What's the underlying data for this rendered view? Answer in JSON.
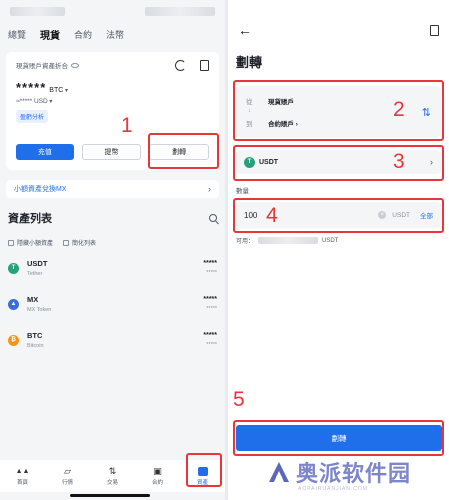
{
  "left": {
    "tabs": [
      "總覽",
      "現貨",
      "合約",
      "法幣"
    ],
    "card": {
      "title": "現貨賬戶資產折合",
      "balance_stars": "*****",
      "balance_unit": "BTC",
      "sub_balance": "≈***** USD",
      "pnl_label": "盈虧分析",
      "buttons": {
        "deposit": "充值",
        "withdraw": "提幣",
        "transfer": "劃轉"
      }
    },
    "promo": {
      "text": "小額資產兌換MX",
      "chevron": "›"
    },
    "list": {
      "title": "資產列表",
      "filter_hide_small": "隱藏小額資產",
      "filter_simple": "簡化列表",
      "coins": [
        {
          "symbol": "USDT",
          "name": "Tether",
          "value": "*****",
          "sub": "*****",
          "icon_letter": "T",
          "color": "#26a17b"
        },
        {
          "symbol": "MX",
          "name": "MX Token",
          "value": "*****",
          "sub": "*****",
          "icon_letter": "▲",
          "color": "#3b6fd8"
        },
        {
          "symbol": "BTC",
          "name": "Bitcoin",
          "value": "*****",
          "sub": "*****",
          "icon_letter": "₿",
          "color": "#f7931a"
        }
      ]
    },
    "nav": [
      {
        "label": "首頁",
        "glyph": "▲▲"
      },
      {
        "label": "行情",
        "glyph": "▱"
      },
      {
        "label": "交易",
        "glyph": "⇅"
      },
      {
        "label": "合約",
        "glyph": "▣"
      },
      {
        "label": "資產",
        "glyph": ""
      }
    ]
  },
  "right": {
    "back_glyph": "←",
    "title": "劃轉",
    "from_label": "從",
    "from_value": "現貨賬戶",
    "to_label": "到",
    "to_value": "合約賬戶 ›",
    "arrow": "↓",
    "swap_glyph": "⇅",
    "coin": "USDT",
    "coin_chevron": "›",
    "qty_label": "數量",
    "qty_value": "100",
    "qty_unit": "USDT",
    "qty_all": "全部",
    "avail_label": "可用：",
    "avail_unit": "USDT",
    "confirm": "劃轉"
  },
  "annotations": [
    "1",
    "2",
    "3",
    "4",
    "5"
  ],
  "watermark": {
    "text": "奥派软件园",
    "sub": "AOPAIRUANJIAN.COM"
  },
  "colors": {
    "accent": "#1f6feb",
    "annotation": "#e8363b"
  }
}
